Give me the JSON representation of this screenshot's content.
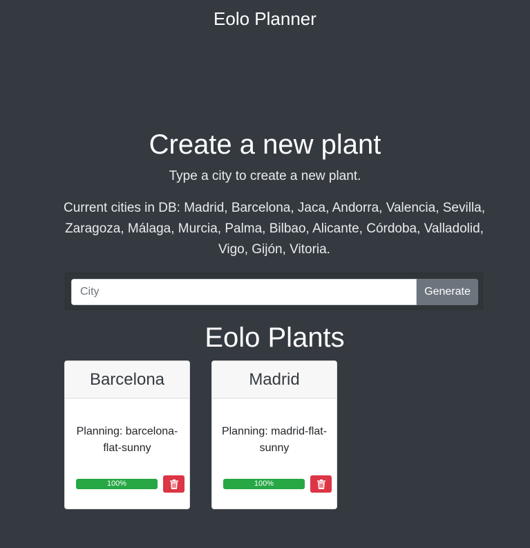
{
  "app": {
    "title": "Eolo Planner"
  },
  "create": {
    "title": "Create a new plant",
    "subtitle": "Type a city to create a new plant.",
    "cities_text": "Current cities in DB: Madrid, Barcelona, Jaca, Andorra, Valencia, Sevilla, Zaragoza, Málaga, Murcia, Palma, Bilbao, Alicante, Córdoba, Valladolid, Vigo, Gijón, Vitoria.",
    "input_placeholder": "City",
    "input_value": "",
    "generate_label": "Generate"
  },
  "plants": {
    "title": "Eolo Plants",
    "items": [
      {
        "city": "Barcelona",
        "planning": "Planning: barcelona-flat-sunny",
        "progress": 100,
        "progress_label": "100%",
        "delete_icon": "trash-icon"
      },
      {
        "city": "Madrid",
        "planning": "Planning: madrid-flat-sunny",
        "progress": 100,
        "progress_label": "100%",
        "delete_icon": "trash-icon"
      }
    ]
  },
  "colors": {
    "background": "#343a40",
    "progress": "#28a745",
    "delete": "#dc3545",
    "generate": "#6c757d"
  }
}
